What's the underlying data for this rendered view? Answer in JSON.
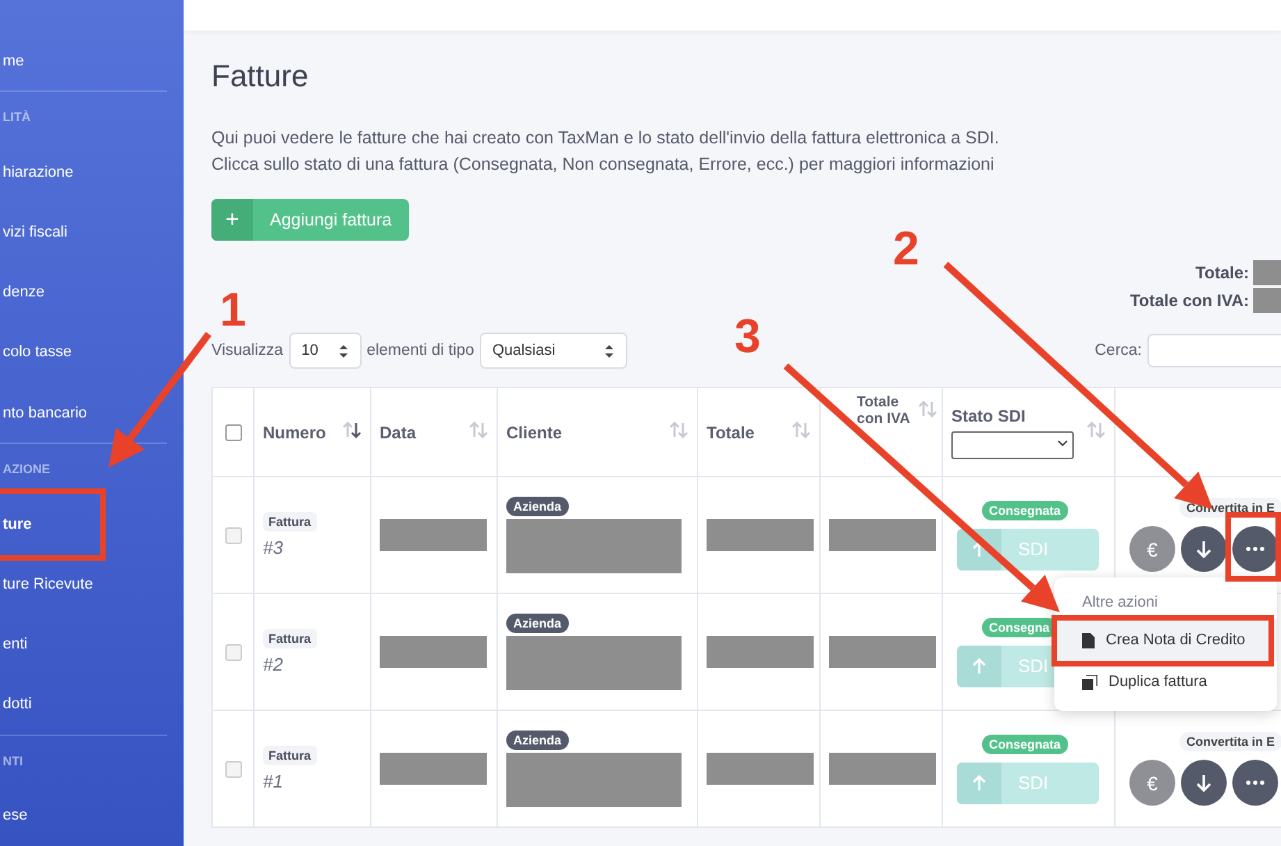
{
  "sidebar": {
    "items": [
      {
        "kind": "item",
        "label": "me",
        "selected": false
      },
      {
        "kind": "section",
        "label": "LITÀ"
      },
      {
        "kind": "item",
        "label": "hiarazione",
        "selected": false
      },
      {
        "kind": "item",
        "label": "vizi fiscali",
        "selected": false
      },
      {
        "kind": "item",
        "label": "denze",
        "selected": false
      },
      {
        "kind": "item",
        "label": "colo tasse",
        "selected": false
      },
      {
        "kind": "item",
        "label": "nto bancario",
        "selected": false
      },
      {
        "kind": "section",
        "label": "AZIONE"
      },
      {
        "kind": "item",
        "label": "ture",
        "selected": true
      },
      {
        "kind": "item",
        "label": "ture Ricevute",
        "selected": false
      },
      {
        "kind": "item",
        "label": "enti",
        "selected": false
      },
      {
        "kind": "item",
        "label": "dotti",
        "selected": false
      },
      {
        "kind": "section",
        "label": "NTI"
      },
      {
        "kind": "item",
        "label": "ese",
        "selected": false
      }
    ]
  },
  "page": {
    "title": "Fatture",
    "description": [
      "Qui puoi vedere le fatture che hai creato con TaxMan e lo stato dell'invio della fattura elettronica a SDI.",
      "Clicca sullo stato di una fattura (Consegnata, Non consegnata, Errore, ecc.) per maggiori informazioni"
    ],
    "add_button": {
      "icon": "+",
      "label": "Aggiungi fattura"
    }
  },
  "totals": [
    {
      "label": "Totale:"
    },
    {
      "label": "Totale con IVA:"
    }
  ],
  "controls": {
    "show_label": "Visualizza",
    "page_size": "10",
    "type_label": "elementi di tipo",
    "type": "Qualsiasi",
    "search_label": "Cerca:"
  },
  "table": {
    "select_all": {
      "checked": false
    },
    "columns": [
      {
        "label": "Numero",
        "sorted": true
      },
      {
        "label": "Data",
        "sorted": false
      },
      {
        "label": "Cliente",
        "sorted": false
      },
      {
        "label": "Totale",
        "sorted": false
      },
      {
        "label": "Totale con IVA",
        "sorted": false
      },
      {
        "label": "Stato SDI",
        "sorted": false,
        "filter": true
      }
    ],
    "rows": [
      {
        "checked": false,
        "doc_type": "Fattura",
        "number": "#3",
        "client_type": "Azienda",
        "status": "Consegnata",
        "sdi": "SDI",
        "conversion": "Convertita in E",
        "currency": "€"
      },
      {
        "checked": false,
        "doc_type": "Fattura",
        "number": "#2",
        "client_type": "Azienda",
        "status": "Consegna",
        "sdi": "SDI"
      },
      {
        "checked": false,
        "doc_type": "Fattura",
        "number": "#1",
        "client_type": "Azienda",
        "status": "Consegnata",
        "sdi": "SDI",
        "conversion": "Convertita in E",
        "currency": "€"
      }
    ]
  },
  "menu": {
    "header": "Altre azioni",
    "items": [
      {
        "kind": "file",
        "label": "Crea Nota di Credito",
        "selected": true
      },
      {
        "kind": "copy",
        "label": "Duplica fattura",
        "selected": false
      }
    ]
  },
  "annotations": [
    {
      "text": "1"
    },
    {
      "text": "2"
    },
    {
      "text": "3"
    }
  ]
}
